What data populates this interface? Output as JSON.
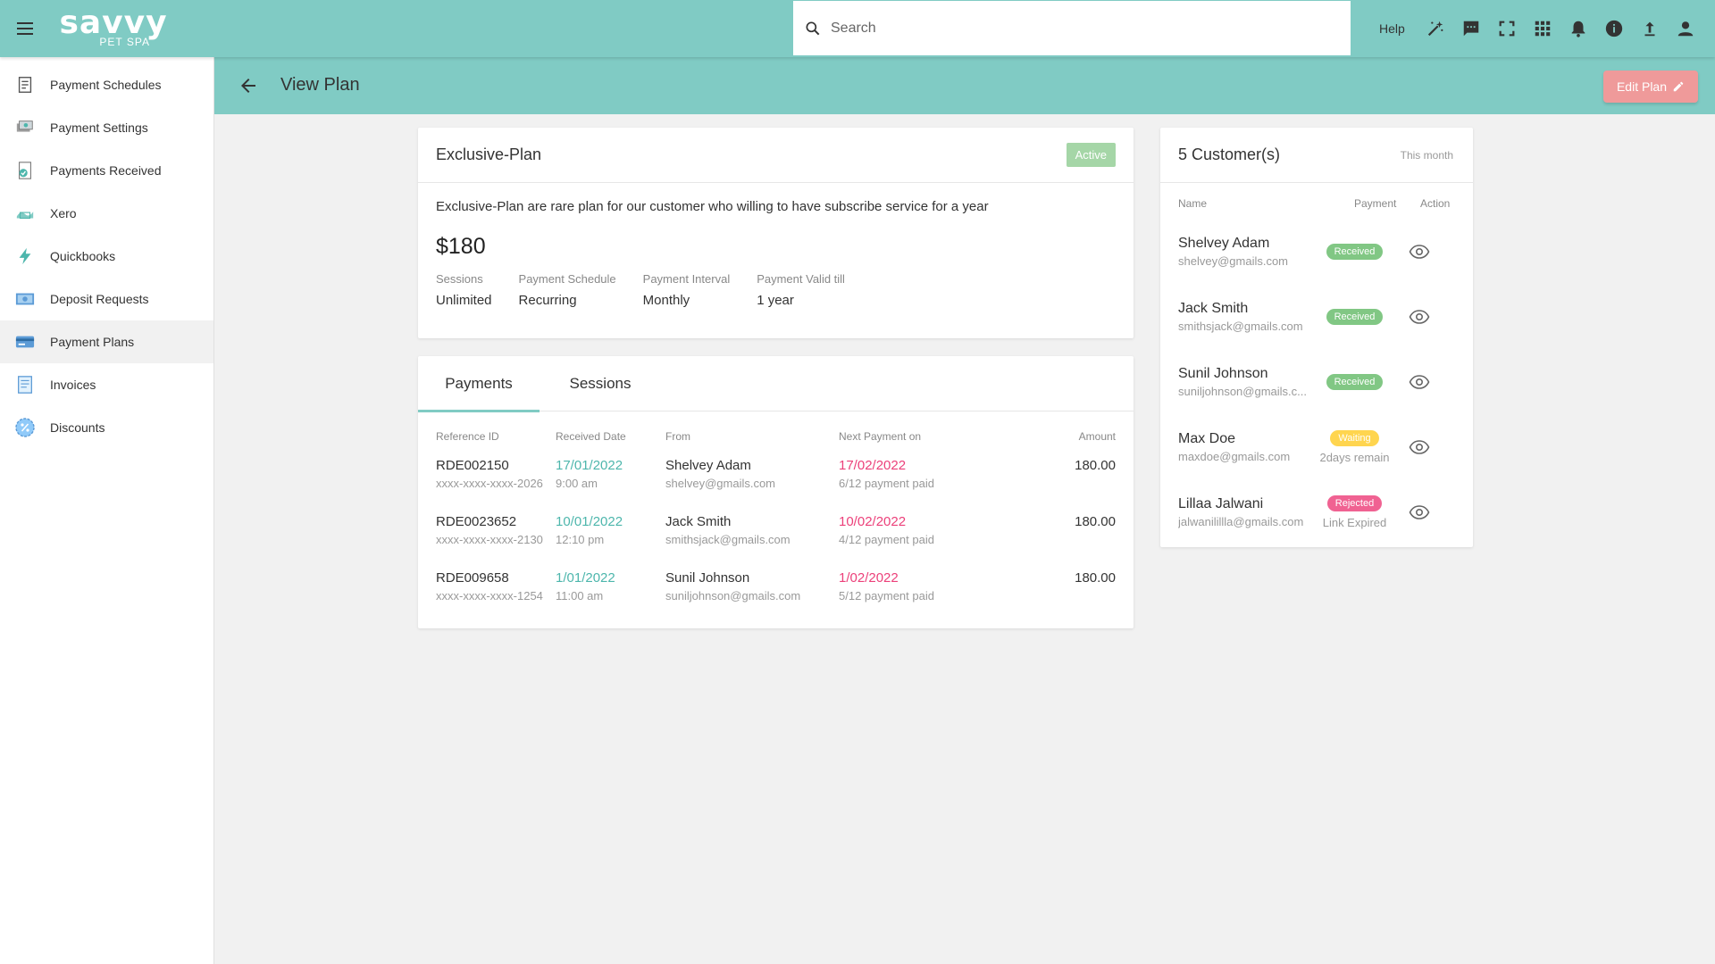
{
  "app": {
    "logo_main": "savvy",
    "logo_sub": "PET SPA",
    "search_placeholder": "Search",
    "help_label": "Help",
    "icons": [
      "magic-wand-icon",
      "chat-icon",
      "fullscreen-icon",
      "apps-grid-icon",
      "bell-icon",
      "info-icon",
      "upload-icon",
      "account-icon"
    ]
  },
  "sidebar": {
    "items": [
      {
        "label": "Payment Schedules",
        "icon": "payment-schedules-icon"
      },
      {
        "label": "Payment Settings",
        "icon": "payment-settings-icon"
      },
      {
        "label": "Payments Received",
        "icon": "payments-received-icon"
      },
      {
        "label": "Xero",
        "icon": "xero-icon"
      },
      {
        "label": "Quickbooks",
        "icon": "quickbooks-icon"
      },
      {
        "label": "Deposit Requests",
        "icon": "deposit-requests-icon"
      },
      {
        "label": "Payment Plans",
        "icon": "payment-plans-icon",
        "active": true
      },
      {
        "label": "Invoices",
        "icon": "invoices-icon"
      },
      {
        "label": "Discounts",
        "icon": "discounts-icon"
      }
    ]
  },
  "header": {
    "title": "View Plan",
    "edit_label": "Edit Plan"
  },
  "plan": {
    "name": "Exclusive-Plan",
    "status": "Active",
    "description": "Exclusive-Plan are rare plan for our customer who willing to have subscribe service for a year",
    "price": "$180",
    "stats": [
      {
        "label": "Sessions",
        "value": "Unlimited"
      },
      {
        "label": "Payment Schedule",
        "value": "Recurring"
      },
      {
        "label": "Payment Interval",
        "value": "Monthly"
      },
      {
        "label": "Payment Valid till",
        "value": "1 year"
      }
    ]
  },
  "payments": {
    "tabs": [
      "Payments",
      "Sessions"
    ],
    "active_tab": "Payments",
    "columns": [
      "Reference ID",
      "Received Date",
      "From",
      "Next Payment on",
      "Amount"
    ],
    "rows": [
      {
        "ref": "RDE002150",
        "card": "xxxx-xxxx-xxxx-2026",
        "date": "17/01/2022",
        "time": "9:00 am",
        "name": "Shelvey Adam",
        "email": "shelvey@gmails.com",
        "next": "17/02/2022",
        "progress": "6/12 payment paid",
        "amount": "180.00"
      },
      {
        "ref": "RDE0023652",
        "card": "xxxx-xxxx-xxxx-2130",
        "date": "10/01/2022",
        "time": "12:10 pm",
        "name": "Jack Smith",
        "email": "smithsjack@gmails.com",
        "next": "10/02/2022",
        "progress": "4/12 payment paid",
        "amount": "180.00"
      },
      {
        "ref": "RDE009658",
        "card": "xxxx-xxxx-xxxx-1254",
        "date": "1/01/2022",
        "time": "11:00 am",
        "name": "Sunil Johnson",
        "email": "suniljohnson@gmails.com",
        "next": "1/02/2022",
        "progress": "5/12 payment paid",
        "amount": "180.00"
      }
    ]
  },
  "customers": {
    "title": "5 Customer(s)",
    "period": "This month",
    "columns": [
      "Name",
      "Payment",
      "Action"
    ],
    "rows": [
      {
        "name": "Shelvey Adam",
        "email": "shelvey@gmails.com",
        "status": "Received",
        "status_type": "received",
        "note": ""
      },
      {
        "name": "Jack Smith",
        "email": "smithsjack@gmails.com",
        "status": "Received",
        "status_type": "received",
        "note": ""
      },
      {
        "name": "Sunil Johnson",
        "email": "suniljohnson@gmails.c...",
        "status": "Received",
        "status_type": "received",
        "note": ""
      },
      {
        "name": "Max Doe",
        "email": "maxdoe@gmails.com",
        "status": "Waiting",
        "status_type": "waiting",
        "note": "2days remain"
      },
      {
        "name": "Lillaa Jalwani",
        "email": "jalwanilillla@gmails.com",
        "status": "Rejected",
        "status_type": "rejected",
        "note": "Link Expired"
      }
    ]
  },
  "colors": {
    "brand": "#80cbc4",
    "accent_pink": "#ec407a",
    "accent_teal": "#4db6ac",
    "edit_button": "#ef9a9a"
  }
}
